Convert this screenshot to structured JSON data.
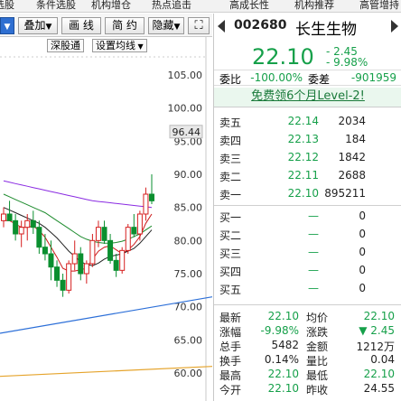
{
  "top_menu": [
    "选股",
    "条件选股",
    "机构增仓",
    "热点追击",
    "高成长性",
    "机构推荐",
    "高管增持"
  ],
  "toolbar": {
    "left_btn": "",
    "overlay": "叠加",
    "draw": "画 线",
    "simple": "简 约",
    "hide": "隐藏",
    "fullscreen": "⛶"
  },
  "chart_subbar": {
    "shenzhen": "深股通",
    "ma_setting": "设置均线"
  },
  "chart_data": {
    "type": "candlestick",
    "ylim": [
      58,
      108
    ],
    "y_ticks": [
      "105.00",
      "100.00",
      "95.00",
      "90.00",
      "85.00",
      "80.00",
      "75.00",
      "70.00",
      "65.00",
      "60.00"
    ],
    "y_tick_values": [
      105,
      100,
      95,
      90,
      85,
      80,
      75,
      70,
      65,
      60
    ],
    "current_price_label": "96.44",
    "current_price_value": 96.44,
    "candles": [
      {
        "o": 83,
        "h": 85,
        "l": 82,
        "c": 84
      },
      {
        "o": 84,
        "h": 86,
        "l": 83,
        "c": 83
      },
      {
        "o": 83,
        "h": 84,
        "l": 80,
        "c": 81
      },
      {
        "o": 81,
        "h": 83,
        "l": 79,
        "c": 82
      },
      {
        "o": 82,
        "h": 84,
        "l": 80,
        "c": 83
      },
      {
        "o": 83,
        "h": 84.5,
        "l": 81,
        "c": 82
      },
      {
        "o": 82,
        "h": 83,
        "l": 78,
        "c": 79
      },
      {
        "o": 79,
        "h": 81,
        "l": 77,
        "c": 78
      },
      {
        "o": 78,
        "h": 80,
        "l": 74,
        "c": 76
      },
      {
        "o": 76,
        "h": 77,
        "l": 73,
        "c": 74
      },
      {
        "o": 74,
        "h": 75,
        "l": 71.5,
        "c": 72.5
      },
      {
        "o": 72.5,
        "h": 77,
        "l": 72,
        "c": 76.5
      },
      {
        "o": 76.5,
        "h": 80,
        "l": 75.5,
        "c": 78
      },
      {
        "o": 78,
        "h": 79,
        "l": 74,
        "c": 75
      },
      {
        "o": 75,
        "h": 77,
        "l": 73.5,
        "c": 76.5
      },
      {
        "o": 76.5,
        "h": 81,
        "l": 76,
        "c": 80
      },
      {
        "o": 80,
        "h": 83,
        "l": 79,
        "c": 82
      },
      {
        "o": 82,
        "h": 83,
        "l": 79.5,
        "c": 80
      },
      {
        "o": 80,
        "h": 81,
        "l": 76.5,
        "c": 77
      },
      {
        "o": 77,
        "h": 78,
        "l": 74.5,
        "c": 75.5
      },
      {
        "o": 75.5,
        "h": 79,
        "l": 75,
        "c": 78.5
      },
      {
        "o": 78.5,
        "h": 82.5,
        "l": 78,
        "c": 82
      },
      {
        "o": 82,
        "h": 84,
        "l": 80.5,
        "c": 81
      },
      {
        "o": 81,
        "h": 84.5,
        "l": 80,
        "c": 84
      },
      {
        "o": 84,
        "h": 88,
        "l": 83,
        "c": 87
      },
      {
        "o": 87,
        "h": 90,
        "l": 85.5,
        "c": 86
      }
    ],
    "ma_lines": [
      {
        "name": "MA5",
        "color": "#cc1a1a",
        "values": [
          83,
          83,
          82.5,
          82,
          82,
          82.2,
          81.5,
          80.5,
          79,
          77.5,
          75.8,
          75.4,
          75.4,
          75.6,
          75.8,
          77.2,
          78.4,
          79,
          79.2,
          78.6,
          78,
          78.6,
          79.4,
          80.6,
          82.6,
          84
        ]
      },
      {
        "name": "MA10",
        "color": "#222222",
        "values": [
          85,
          84.6,
          84.2,
          83.8,
          83.4,
          83,
          82.6,
          82,
          81.2,
          80.4,
          79.4,
          78.4,
          77.6,
          76.8,
          76.4,
          76.2,
          76.6,
          77.2,
          77.6,
          77.8,
          78,
          78.4,
          78.8,
          79.6,
          80.6,
          81.6
        ]
      },
      {
        "name": "MA20",
        "color": "#1e8c2e",
        "values": [
          87,
          86.6,
          86.2,
          85.8,
          85.4,
          85,
          84.6,
          84.2,
          83.6,
          83,
          82.4,
          81.8,
          81.2,
          80.6,
          80.2,
          79.9,
          79.7,
          79.6,
          79.6,
          79.7,
          79.9,
          80.2,
          80.6,
          81,
          81.6,
          82.2
        ]
      },
      {
        "name": "MA60",
        "color": "#8a2be2",
        "values": [
          89,
          88.8,
          88.6,
          88.4,
          88.2,
          88,
          87.8,
          87.6,
          87.4,
          87.2,
          87,
          86.8,
          86.6,
          86.4,
          86.2,
          86,
          85.9,
          85.8,
          85.7,
          85.6,
          85.5,
          85.4,
          85.3,
          85.2,
          85.1,
          85
        ]
      }
    ],
    "extra_lines": [
      {
        "name": "",
        "color": "#2c6fd8",
        "from": [
          0,
          66
        ],
        "to": [
          235,
          71.5
        ]
      },
      {
        "name": "",
        "color": "#e5a32a",
        "from": [
          0,
          59.5
        ],
        "to": [
          235,
          61
        ]
      }
    ]
  },
  "panel": {
    "code": "002680",
    "name": "长生生物",
    "price": "22.10",
    "change": "- 2.45",
    "change_pct": "- 9.98%",
    "weibi_label": "委比",
    "weibi_value": "-100.00%",
    "weicha_label": "委差",
    "weicha_value": "-901959",
    "promo": "免费领6个月Level-2!",
    "sell": [
      {
        "label": "卖五",
        "price": "22.14",
        "vol": "2034"
      },
      {
        "label": "卖四",
        "price": "22.13",
        "vol": "184"
      },
      {
        "label": "卖三",
        "price": "22.12",
        "vol": "1842"
      },
      {
        "label": "卖二",
        "price": "22.11",
        "vol": "2688"
      },
      {
        "label": "卖一",
        "price": "22.10",
        "vol": "895211"
      }
    ],
    "buy": [
      {
        "label": "买一",
        "price": "—",
        "vol": "0"
      },
      {
        "label": "买二",
        "price": "—",
        "vol": "0"
      },
      {
        "label": "买三",
        "price": "—",
        "vol": "0"
      },
      {
        "label": "买四",
        "price": "—",
        "vol": "0"
      },
      {
        "label": "买五",
        "price": "—",
        "vol": "0"
      }
    ],
    "stats": [
      {
        "l1": "最新",
        "v1": "22.10",
        "c1": "green",
        "l2": "均价",
        "v2": "22.10",
        "c2": "green"
      },
      {
        "l1": "涨幅",
        "v1": "-9.98%",
        "c1": "green",
        "l2": "涨跌",
        "v2": "▼ 2.45",
        "c2": "green"
      },
      {
        "l1": "总手",
        "v1": "5482",
        "c1": "black",
        "l2": "金额",
        "v2": "1212万",
        "c2": "black"
      },
      {
        "l1": "换手",
        "v1": "0.14%",
        "c1": "black",
        "l2": "量比",
        "v2": "0.04",
        "c2": "black"
      },
      {
        "l1": "最高",
        "v1": "22.10",
        "c1": "green",
        "l2": "最低",
        "v2": "22.10",
        "c2": "green"
      },
      {
        "l1": "今开",
        "v1": "22.10",
        "c1": "green",
        "l2": "昨收",
        "v2": "24.55",
        "c2": "black"
      }
    ]
  }
}
